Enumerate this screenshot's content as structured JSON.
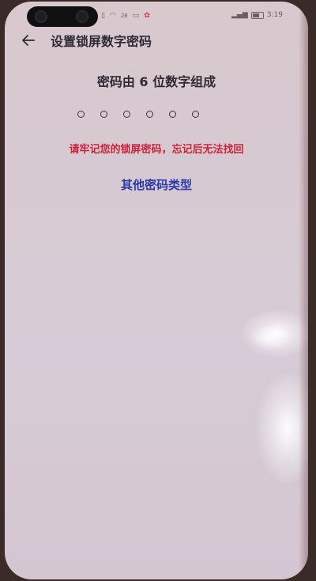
{
  "status_bar": {
    "time": "3:19",
    "signal_text": "26",
    "icons": [
      "sim-icon",
      "wifi-icon",
      "data-icon",
      "app-notification-icon",
      "signal-icon",
      "battery-icon"
    ]
  },
  "header": {
    "back_icon": "back-arrow-icon",
    "title": "设置锁屏数字密码"
  },
  "prompt": "密码由 6 位数字组成",
  "pin": {
    "length": 6,
    "entered": 0
  },
  "warning": "请牢记您的锁屏密码，忘记后无法找回",
  "other_type_link": "其他密码类型",
  "colors": {
    "warning": "#c8243c",
    "link": "#2c3aa8",
    "text": "#2f2a36"
  }
}
